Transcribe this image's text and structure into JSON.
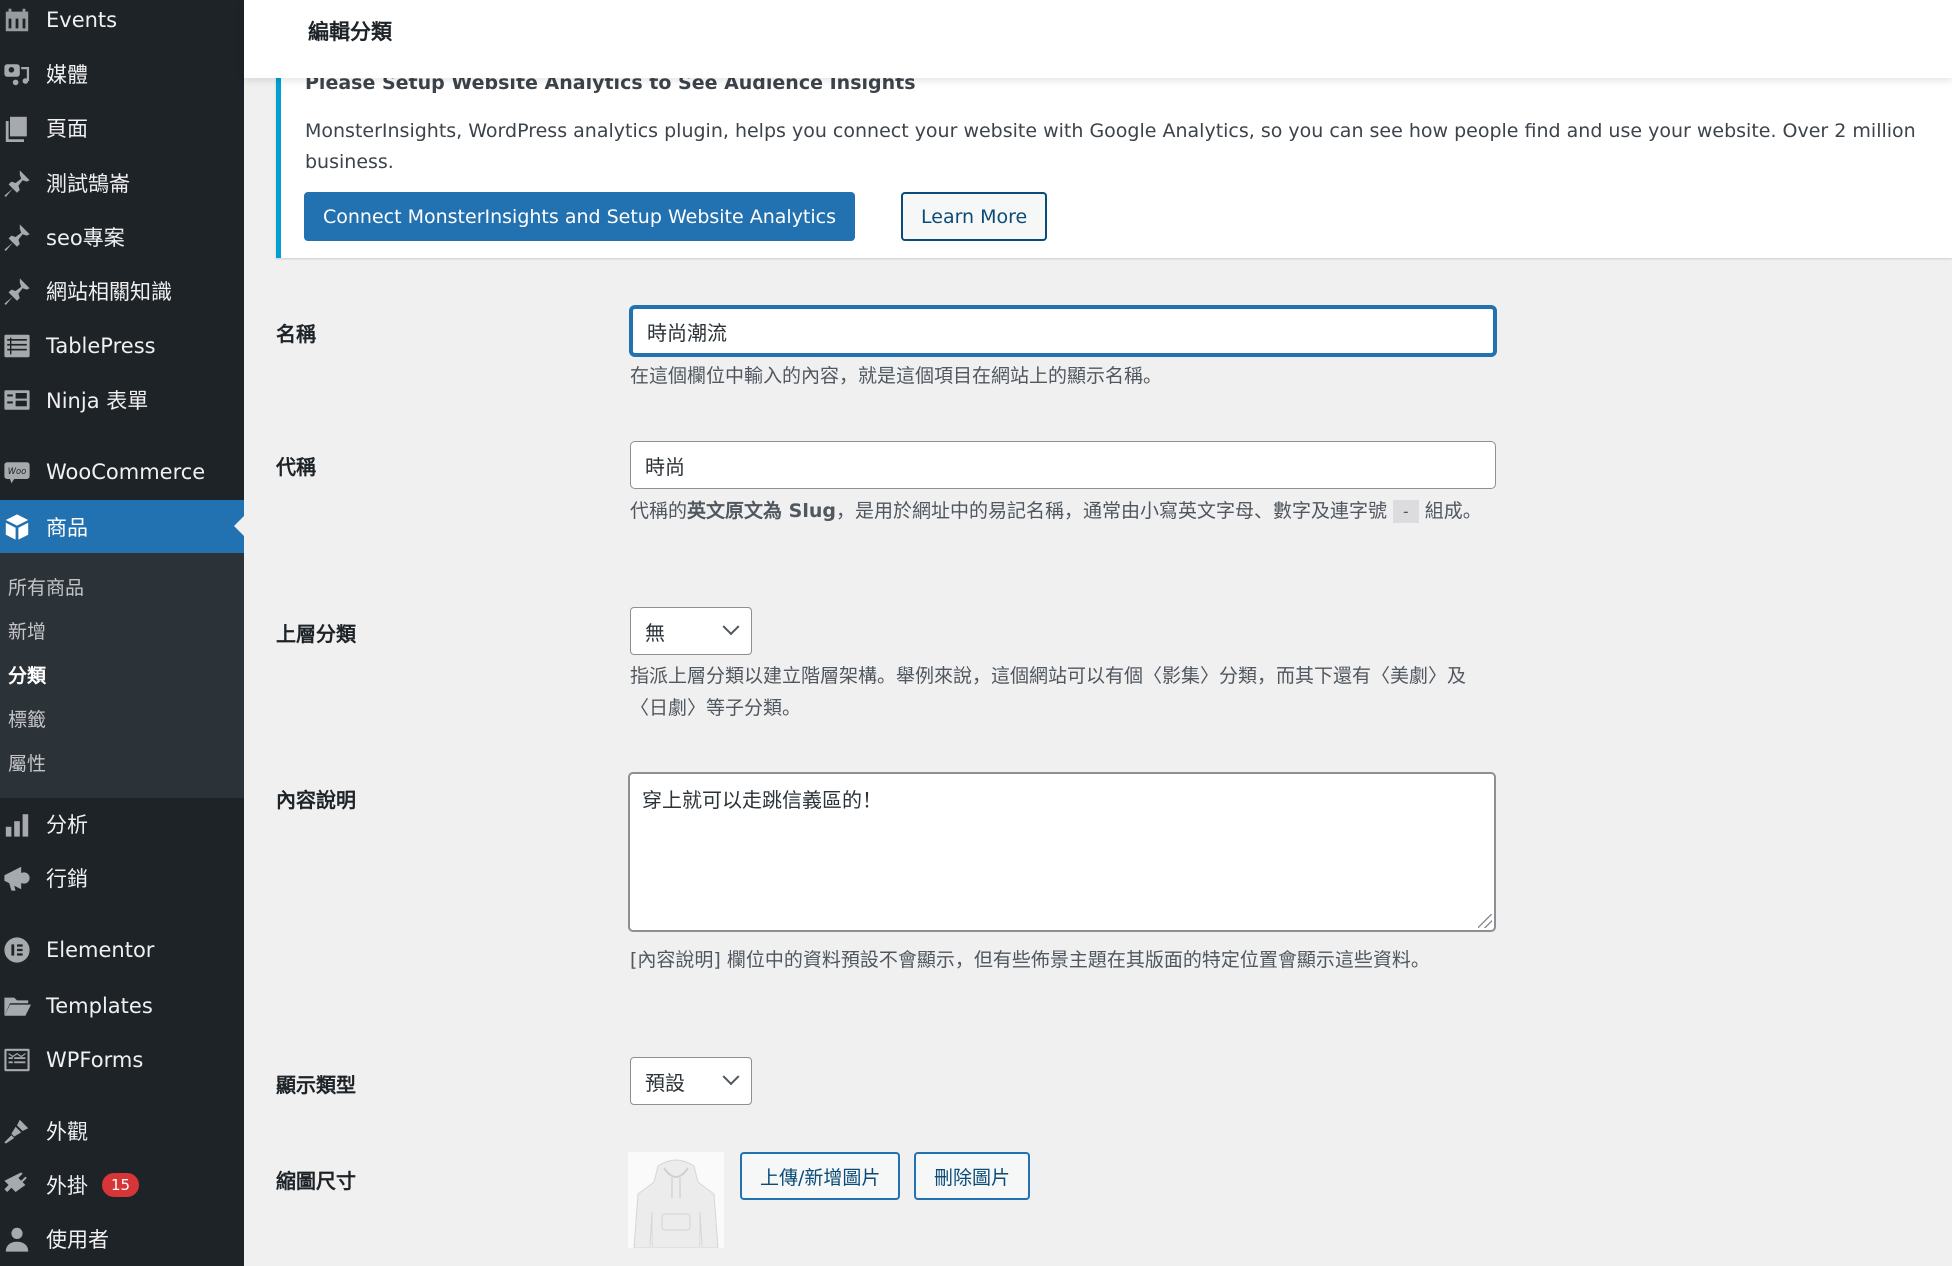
{
  "sidebar": {
    "items": [
      {
        "label": "Events",
        "icon": "calendar-icon"
      },
      {
        "label": "媒體",
        "icon": "media-icon"
      },
      {
        "label": "頁面",
        "icon": "pages-icon"
      },
      {
        "label": "測試鵠崙",
        "icon": "pin-icon"
      },
      {
        "label": "seo專案",
        "icon": "pin-icon"
      },
      {
        "label": "網站相關知識",
        "icon": "pin-icon"
      },
      {
        "label": "TablePress",
        "icon": "table-icon"
      },
      {
        "label": "Ninja 表單",
        "icon": "form-icon"
      },
      {
        "label": "WooCommerce",
        "icon": "woo-icon"
      },
      {
        "label": "商品",
        "icon": "box-icon",
        "active": true
      },
      {
        "label": "分析",
        "icon": "bar-chart-icon"
      },
      {
        "label": "行銷",
        "icon": "megaphone-icon"
      },
      {
        "label": "Elementor",
        "icon": "elementor-icon"
      },
      {
        "label": "Templates",
        "icon": "folder-icon"
      },
      {
        "label": "WPForms",
        "icon": "wpforms-icon"
      },
      {
        "label": "外觀",
        "icon": "brush-icon"
      },
      {
        "label": "外掛",
        "icon": "plugin-icon",
        "badge": "15"
      },
      {
        "label": "使用者",
        "icon": "user-icon"
      }
    ],
    "submenu": [
      {
        "label": "所有商品"
      },
      {
        "label": "新增"
      },
      {
        "label": "分類",
        "current": true
      },
      {
        "label": "標籤"
      },
      {
        "label": "屬性"
      }
    ]
  },
  "header": {
    "title": "編輯分類"
  },
  "notice": {
    "title": "Please Setup Website Analytics to See Audience Insights",
    "body": "MonsterInsights, WordPress analytics plugin, helps you connect your website with Google Analytics, so you can see how people find and use your website. Over 2 million business.",
    "primary_button": "Connect MonsterInsights and Setup Website Analytics",
    "secondary_button": "Learn More",
    "accent_color": "#00a0d2"
  },
  "form": {
    "name": {
      "label": "名稱",
      "value": "時尚潮流",
      "description": "在這個欄位中輸入的內容，就是這個項目在網站上的顯示名稱。"
    },
    "slug": {
      "label": "代稱",
      "value": "時尚",
      "description_prefix": "代稱的",
      "description_bold": "英文原文為 Slug",
      "description_mid": "，是用於網址中的易記名稱，通常由小寫英文字母、數字及連字號",
      "description_code": "-",
      "description_suffix": "組成。"
    },
    "parent": {
      "label": "上層分類",
      "selected": "無",
      "description": "指派上層分類以建立階層架構。舉例來說，這個網站可以有個〈影集〉分類，而其下還有〈美劇〉及〈日劇〉等子分類。"
    },
    "description": {
      "label": "內容說明",
      "value": "穿上就可以走跳信義區的！",
      "help": "[內容說明] 欄位中的資料預設不會顯示，但有些佈景主題在其版面的特定位置會顯示這些資料。"
    },
    "display_type": {
      "label": "顯示類型",
      "selected": "預設"
    },
    "thumbnail": {
      "label": "縮圖尺寸",
      "upload_button": "上傳/新增圖片",
      "remove_button": "刪除圖片"
    }
  },
  "colors": {
    "sidebar_bg": "#1d2327",
    "submenu_bg": "#2c3338",
    "active": "#2271b1",
    "badge": "#d63638"
  }
}
